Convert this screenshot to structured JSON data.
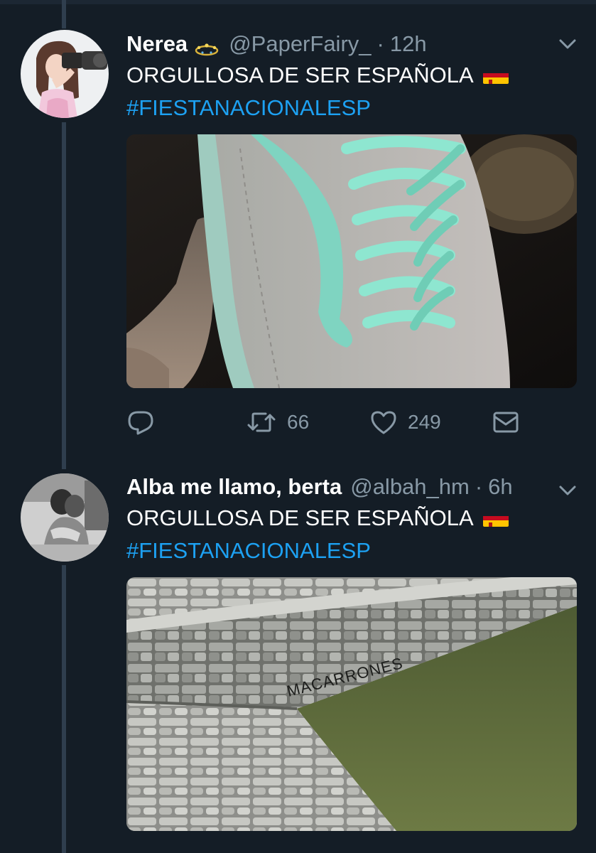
{
  "colors": {
    "background": "#141d26",
    "text_primary": "#ffffff",
    "text_secondary": "#8899a6",
    "link": "#1da1f2",
    "thread_line": "#2f3e4e"
  },
  "tweets": [
    {
      "name": "Nerea",
      "badge_icon": "crown-emoji-icon",
      "handle": "@PaperFairy_",
      "separator": "·",
      "time": "12h",
      "text": "ORGULLOSA DE SER ESPAÑOLA",
      "flag_icon": "spain-flag-icon",
      "hashtag": "#FIESTANACIONALESP",
      "media_description_icon": "sneaker-photo",
      "replies": "",
      "retweets": "66",
      "likes": "249"
    },
    {
      "name": "Alba me llamo, berta",
      "handle": "@albah_hm",
      "separator": "·",
      "time": "6h",
      "text": "ORGULLOSA DE SER ESPAÑOLA",
      "flag_icon": "spain-flag-icon",
      "hashtag": "#FIESTANACIONALESP",
      "media_graffiti": "MACARRONES"
    }
  ]
}
